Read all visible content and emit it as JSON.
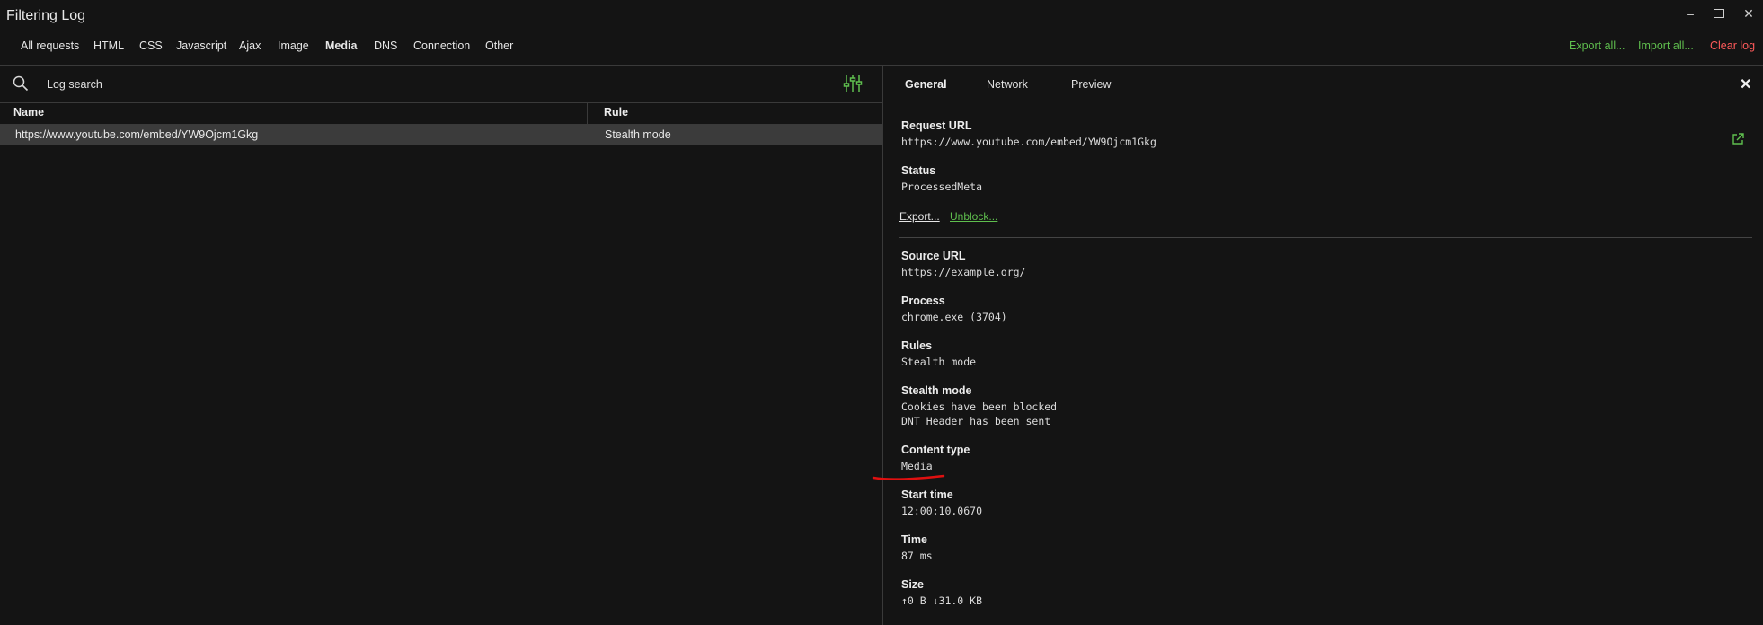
{
  "window": {
    "title": "Filtering Log"
  },
  "filters": [
    {
      "label": "All requests",
      "active": false
    },
    {
      "label": "HTML",
      "active": false
    },
    {
      "label": "CSS",
      "active": false
    },
    {
      "label": "Javascript",
      "active": false
    },
    {
      "label": "Ajax",
      "active": false
    },
    {
      "label": "Image",
      "active": false
    },
    {
      "label": "Media",
      "active": true
    },
    {
      "label": "DNS",
      "active": false
    },
    {
      "label": "Connection",
      "active": false
    },
    {
      "label": "Other",
      "active": false
    }
  ],
  "actions": {
    "export_all": "Export all...",
    "import_all": "Import all...",
    "clear_log": "Clear log"
  },
  "search": {
    "placeholder": "Log search"
  },
  "table": {
    "columns": [
      "Name",
      "Rule"
    ],
    "rows": [
      {
        "name": "https://www.youtube.com/embed/YW9Ojcm1Gkg",
        "rule": "Stealth mode"
      }
    ]
  },
  "details": {
    "tabs": [
      "General",
      "Network",
      "Preview"
    ],
    "active_tab": "General",
    "request_url_label": "Request URL",
    "request_url": "https://www.youtube.com/embed/YW9Ojcm1Gkg",
    "status_label": "Status",
    "status": "ProcessedMeta",
    "export_link": "Export...",
    "unblock_link": "Unblock...",
    "source_url_label": "Source URL",
    "source_url": "https://example.org/",
    "process_label": "Process",
    "process": "chrome.exe (3704)",
    "rules_label": "Rules",
    "rules": "Stealth mode",
    "stealth_label": "Stealth mode",
    "stealth_lines": [
      "Cookies have been blocked",
      "DNT Header has been sent"
    ],
    "content_type_label": "Content type",
    "content_type": "Media",
    "start_time_label": "Start time",
    "start_time": "12:00:10.0670",
    "time_label": "Time",
    "time": "87 ms",
    "size_label": "Size",
    "size": "↑0 B ↓31.0 KB"
  },
  "colors": {
    "background": "#141414",
    "selected_row": "#3b3b3b",
    "green_action": "#5fbf4e",
    "red_action": "#ff5a5a",
    "annotation_red": "#e01010"
  }
}
